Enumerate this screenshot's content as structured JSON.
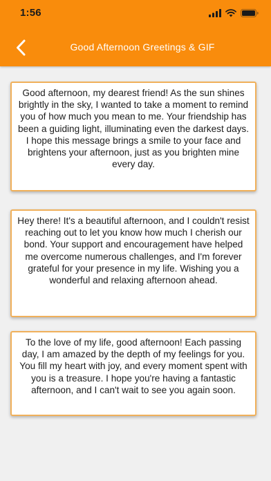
{
  "status_bar": {
    "time": "1:56",
    "icons": [
      "signal-icon",
      "wifi-icon",
      "battery-icon"
    ]
  },
  "header": {
    "title": "Good Afternoon Greetings & GIF",
    "back_icon": "chevron-left-icon",
    "background_color": "#f98c0c",
    "text_color": "#ffffff"
  },
  "cards": [
    {
      "text": "Good afternoon, my dearest friend! As the sun shines brightly in the sky, I wanted to take a moment to remind you of how much you mean to me. Your friendship has been a guiding light, illuminating even the darkest days. I hope this message brings a smile to your face and brightens your afternoon, just as you brighten mine every day."
    },
    {
      "text": "Hey there! It's a beautiful afternoon, and I couldn't resist reaching out to let you know how much I cherish our bond. Your support and encouragement have helped me overcome numerous challenges, and I'm forever grateful for your presence in my life. Wishing you a wonderful and relaxing afternoon ahead."
    },
    {
      "text": "To the love of my life, good afternoon! Each passing day, I am amazed by the depth of my feelings for you. You fill my heart with joy, and every moment spent with you is a treasure. I hope you're having a fantastic afternoon, and I can't wait to see you again soon."
    }
  ],
  "colors": {
    "page_background": "#f0f0f0",
    "card_border": "#f0b05a",
    "card_background": "#ffffff"
  }
}
